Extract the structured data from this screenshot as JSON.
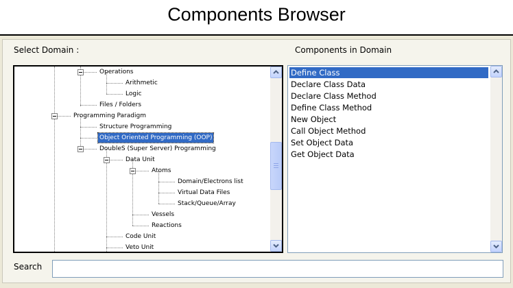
{
  "title": "Components Browser",
  "labels": {
    "select_domain": "Select Domain :",
    "components_in_domain": "Components in Domain",
    "search": "Search"
  },
  "search": {
    "value": "",
    "placeholder": ""
  },
  "tree": {
    "selected": "Object Oriented Programming (OOP)",
    "nodes": [
      {
        "label": "Operations",
        "level": 2,
        "expanded": true
      },
      {
        "label": "Arithmetic",
        "level": 3
      },
      {
        "label": "Logic",
        "level": 3
      },
      {
        "label": "Files / Folders",
        "level": 2
      },
      {
        "label": "Programming Paradigm",
        "level": 1,
        "expanded": true
      },
      {
        "label": "Structure Programming",
        "level": 2
      },
      {
        "label": "Object Oriented Programming (OOP)",
        "level": 2,
        "selected": true
      },
      {
        "label": "DoubleS (Super Server) Programming",
        "level": 2,
        "expanded": true
      },
      {
        "label": "Data Unit",
        "level": 3,
        "expanded": true
      },
      {
        "label": "Atoms",
        "level": 4,
        "expanded": true
      },
      {
        "label": "Domain/Electrons list",
        "level": 5
      },
      {
        "label": "Virtual Data Files",
        "level": 5
      },
      {
        "label": "Stack/Queue/Array",
        "level": 5
      },
      {
        "label": "Vessels",
        "level": 4
      },
      {
        "label": "Reactions",
        "level": 4
      },
      {
        "label": "Code Unit",
        "level": 3
      },
      {
        "label": "Veto Unit",
        "level": 3
      }
    ],
    "scroll_position": 0.55
  },
  "components": {
    "selected": "Define Class",
    "items": [
      "Define Class",
      "Declare Class Data",
      "Declare Class Method",
      "Define Class Method",
      "New Object",
      "Call Object Method",
      "Set Object Data",
      "Get Object Data"
    ]
  },
  "colors": {
    "selection": "#316ac5",
    "window_bg": "#ece9d8",
    "border": "#7f9db9"
  }
}
